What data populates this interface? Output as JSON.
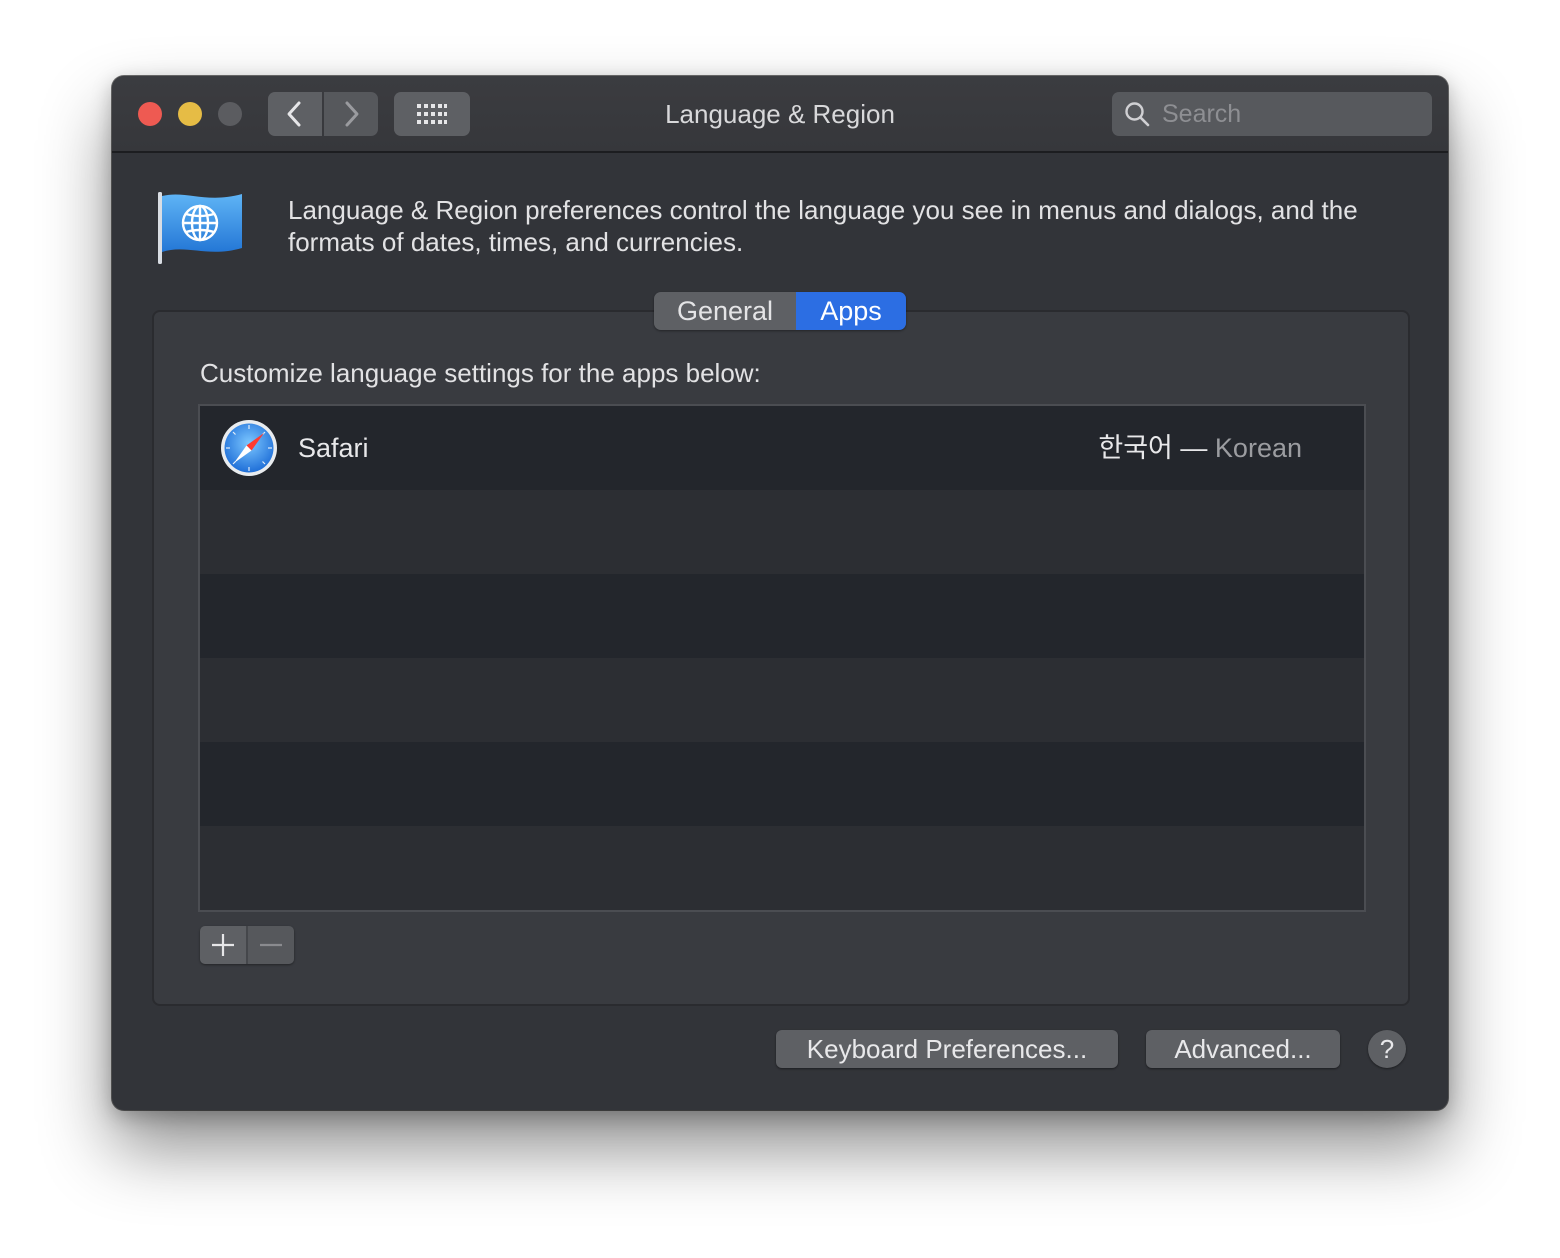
{
  "window": {
    "title": "Language & Region",
    "search_placeholder": "Search"
  },
  "toolbar": {
    "back_icon": "chevron-left-icon",
    "forward_icon": "chevron-right-icon",
    "show_all_icon": "grid-icon"
  },
  "header": {
    "icon": "flag-globe-icon",
    "description": "Language & Region preferences control the language you see in menus and dialogs, and the formats of dates, times, and currencies."
  },
  "tabs": [
    {
      "label": "General",
      "selected": false
    },
    {
      "label": "Apps",
      "selected": true
    }
  ],
  "apps_panel": {
    "instruction": "Customize language settings for the apps below:",
    "apps": [
      {
        "name": "Safari",
        "icon": "safari-compass-icon",
        "language_native": "한국어",
        "separator": "—",
        "language_english": "Korean"
      }
    ],
    "add_icon": "plus-icon",
    "remove_icon": "minus-icon"
  },
  "footer": {
    "keyboard_button": "Keyboard Preferences...",
    "advanced_button": "Advanced...",
    "help_label": "?"
  },
  "colors": {
    "close": "#ee5a52",
    "minimize": "#e6bc45",
    "zoom_inactive": "#5b5c60",
    "accent": "#2c6ee3",
    "window_bg": "#323439"
  }
}
